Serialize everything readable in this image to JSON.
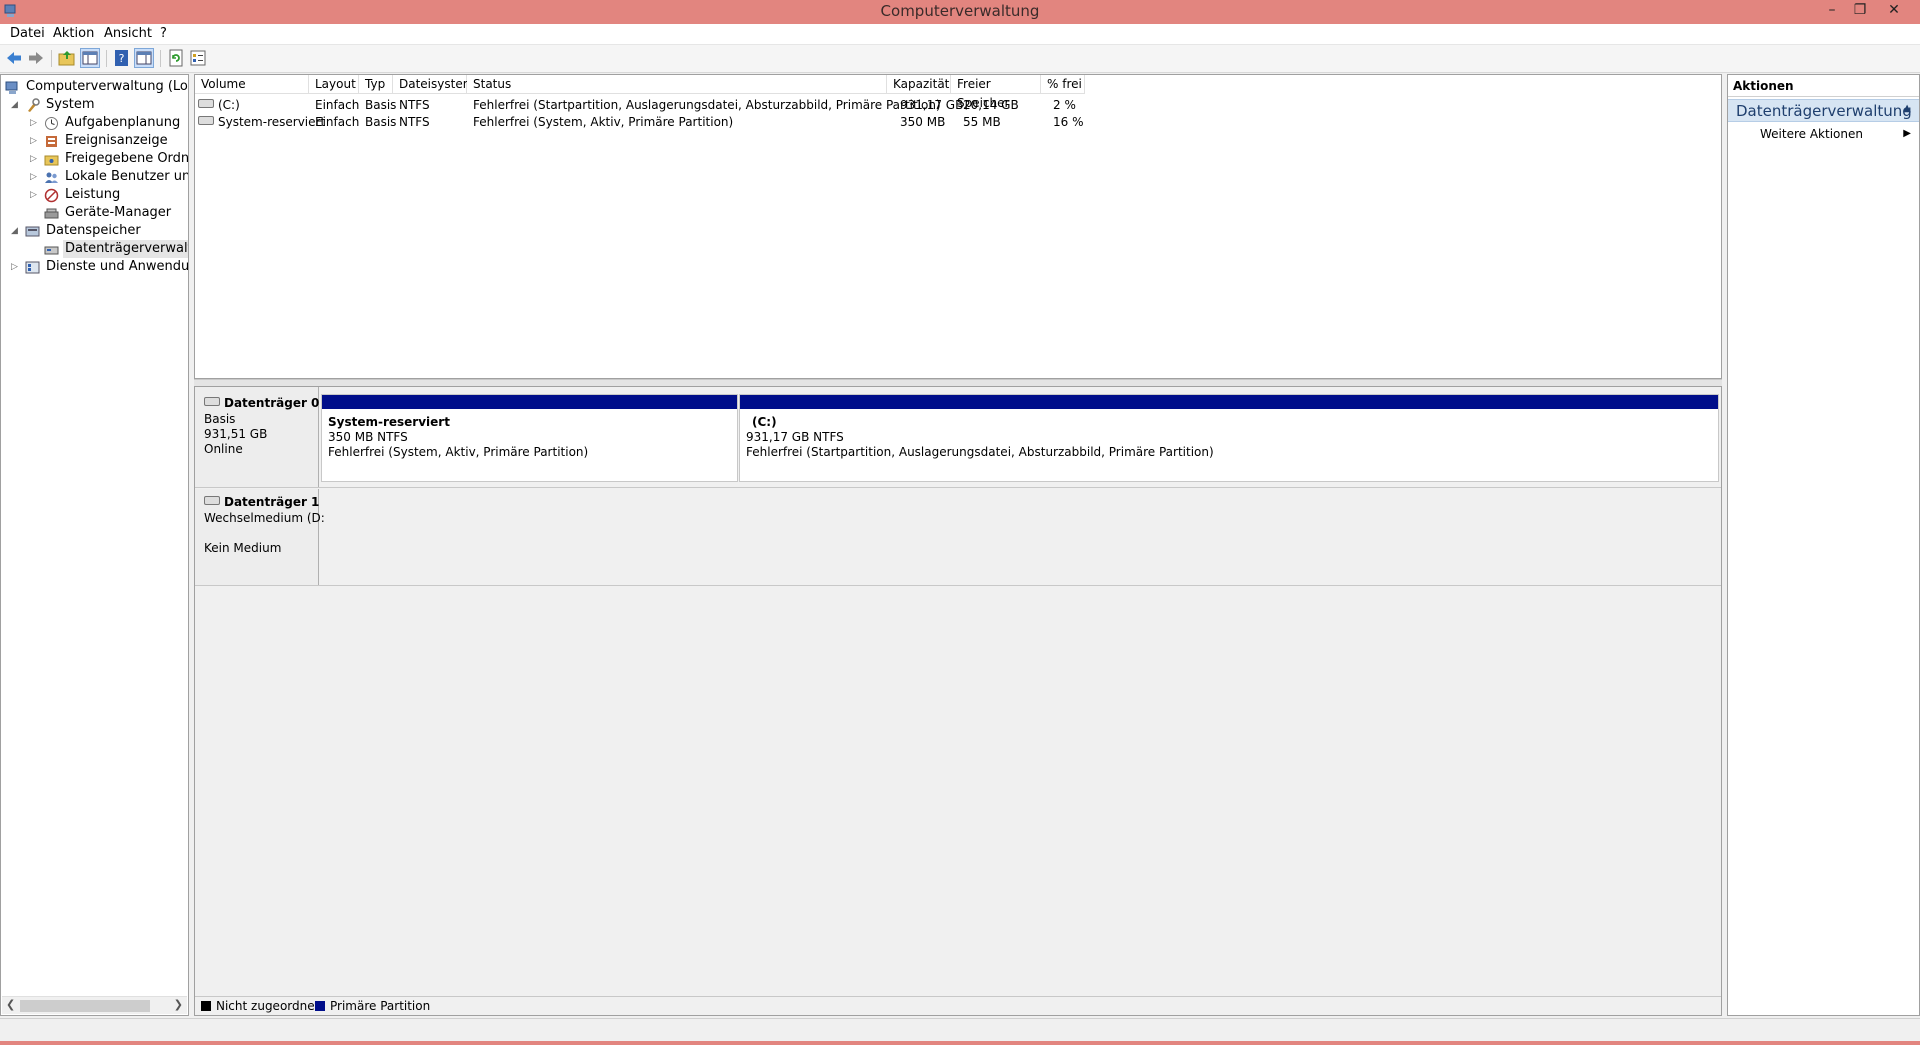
{
  "window": {
    "title": "Computerverwaltung"
  },
  "menu": [
    "Datei",
    "Aktion",
    "Ansicht",
    "?"
  ],
  "tree": {
    "root": "Computerverwaltung (Lokal)",
    "system": "System",
    "aufgabenplanung": "Aufgabenplanung",
    "ereignisanzeige": "Ereignisanzeige",
    "freigegebene_ordner": "Freigegebene Ordner",
    "lokale_benutzer": "Lokale Benutzer und Gr",
    "leistung": "Leistung",
    "geraete_manager": "Geräte-Manager",
    "datenspeicher": "Datenspeicher",
    "datentraegerverwaltung": "Datenträgerverwaltung",
    "dienste": "Dienste und Anwendungen"
  },
  "volumes": {
    "headers": [
      "Volume",
      "Layout",
      "Typ",
      "Dateisystem",
      "Status",
      "Kapazität",
      "Freier Speicher",
      "% frei"
    ],
    "rows": [
      [
        "(C:)",
        "Einfach",
        "Basis",
        "NTFS",
        "Fehlerfrei (Startpartition, Auslagerungsdatei, Absturzabbild, Primäre Partition)",
        "931,17 GB",
        "20,14 GB",
        "2 %"
      ],
      [
        "System-reserviert",
        "Einfach",
        "Basis",
        "NTFS",
        "Fehlerfrei (System, Aktiv, Primäre Partition)",
        "350 MB",
        "55 MB",
        "16 %"
      ]
    ]
  },
  "disks": {
    "disk0": {
      "title": "Datenträger 0",
      "type": "Basis",
      "size": "931,51 GB",
      "state": "Online",
      "partitions": [
        {
          "name": "System-reserviert",
          "size": "350 MB NTFS",
          "status": "Fehlerfrei (System, Aktiv, Primäre Partition)"
        },
        {
          "name": "(C:)",
          "size": "931,17 GB NTFS",
          "status": "Fehlerfrei (Startpartition, Auslagerungsdatei, Absturzabbild, Primäre Partition)"
        }
      ]
    },
    "disk1": {
      "title": "Datenträger 1",
      "type": "Wechselmedium (D:",
      "state": "Kein Medium"
    }
  },
  "legend": {
    "unallocated": "Nicht zugeordnet",
    "primary": "Primäre Partition",
    "unallocated_color": "#000000",
    "primary_color": "#000e8a"
  },
  "actions": {
    "header": "Aktionen",
    "group": "Datenträgerverwaltung",
    "item": "Weitere Aktionen"
  },
  "colors": {
    "titlebar": "#e2857f",
    "partition_bar": "#000e8a",
    "action_group": "#d7e5f3"
  }
}
